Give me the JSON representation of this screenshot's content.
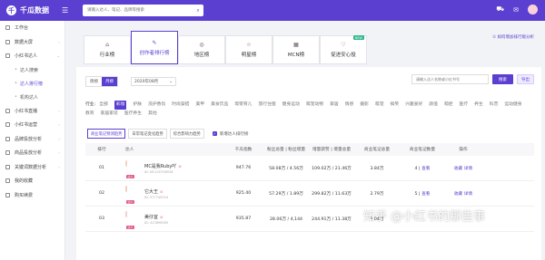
{
  "app": {
    "title": "千瓜数据",
    "search_placeholder": "请输入达人、笔记、品牌等搜索"
  },
  "sidebar": {
    "items": [
      {
        "label": "工作台"
      },
      {
        "label": "数据大屏",
        "chev": "›"
      },
      {
        "label": "小红书达人",
        "chev": "⌄"
      }
    ],
    "subitems": [
      {
        "label": "达人搜索"
      },
      {
        "label": "达人排行榜"
      },
      {
        "label": "机构达人"
      }
    ],
    "items2": [
      {
        "label": "小红书直播",
        "chev": "›"
      },
      {
        "label": "小红书运营",
        "chev": "›"
      },
      {
        "label": "品牌投放分析",
        "chev": "›"
      },
      {
        "label": "商品投放分析",
        "chev": "›"
      },
      {
        "label": "关键词数据分析",
        "chev": "›"
      },
      {
        "label": "我的收藏"
      },
      {
        "label": "购买续费"
      }
    ]
  },
  "cards": [
    {
      "label": "行业榜",
      "icon": "⌂"
    },
    {
      "label": "创作者排行榜",
      "icon": "✎"
    },
    {
      "label": "地区榜",
      "icon": "◎"
    },
    {
      "label": "明星榜",
      "icon": "☆"
    },
    {
      "label": "MCN榜",
      "icon": "▦"
    },
    {
      "label": "促进安心投",
      "icon": "♡",
      "tag": "NEW"
    }
  ],
  "help_link": "① 如何增加排行版分析",
  "controls": {
    "period": [
      "周榜",
      "月榜"
    ],
    "month": "2020年08月",
    "search_placeholder": "请输入达人名称或小红书号",
    "search_btn": "搜索",
    "export_btn": "导出"
  },
  "industry": {
    "label": "行业:",
    "items": [
      "全部",
      "彩妆",
      "护肤",
      "洗护香氛",
      "时尚穿搭",
      "美甲",
      "美食饮品",
      "母婴育儿",
      "旅行住宿",
      "健身运动",
      "萌宠动物",
      "家居",
      "情感",
      "摄影",
      "萌宠",
      "搞笑",
      "兴趣爱好",
      "颜值",
      "萌娃",
      "医疗",
      "养生",
      "科普",
      "运动健身",
      "教育",
      "家居家装",
      "医疗养生",
      "其他"
    ]
  },
  "subtabs": [
    "商业笔记预测趋势",
    "日常笔记变化趋势",
    "综合影响力趋势"
  ],
  "checkbox_label": "新增达人排行榜",
  "columns": [
    "排行",
    "达人",
    "千瓜指数",
    "粉丝总量 | 粉丝增量",
    "增量获赞 | 增量总量",
    "商业笔记总量",
    "商业笔记数量",
    "操作"
  ],
  "rows": [
    {
      "rank": "01",
      "name": "MC是我Ruby吖",
      "id": "ID: MC220798538",
      "badge": "达人",
      "score": "947.76",
      "fans": "58.08万 / 4.56万",
      "likes": "109.02万 / 21.46万",
      "biz": "3.84万",
      "count": "4",
      "sub": "查看",
      "op1": "收藏",
      "op2": "详情"
    },
    {
      "rank": "02",
      "name": "它大王",
      "id": "ID: 377749254",
      "badge": "达人",
      "score": "925.40",
      "fans": "57.29万 / 1.89万",
      "likes": "299.82万 / 11.63万",
      "biz": "2.79万",
      "count": "5",
      "sub": "查看",
      "op1": "收藏",
      "op2": "详情"
    },
    {
      "rank": "03",
      "name": "美仔宜",
      "id": "ID: 423696585",
      "badge": "达人",
      "score": "935.87",
      "fans": "28.06万 / 4,144",
      "likes": "244.91万 / 11.38万",
      "biz": "1.04万",
      "count": "",
      "sub": "",
      "op1": "",
      "op2": ""
    }
  ],
  "watermark": "知乎 @小红书的那些事"
}
